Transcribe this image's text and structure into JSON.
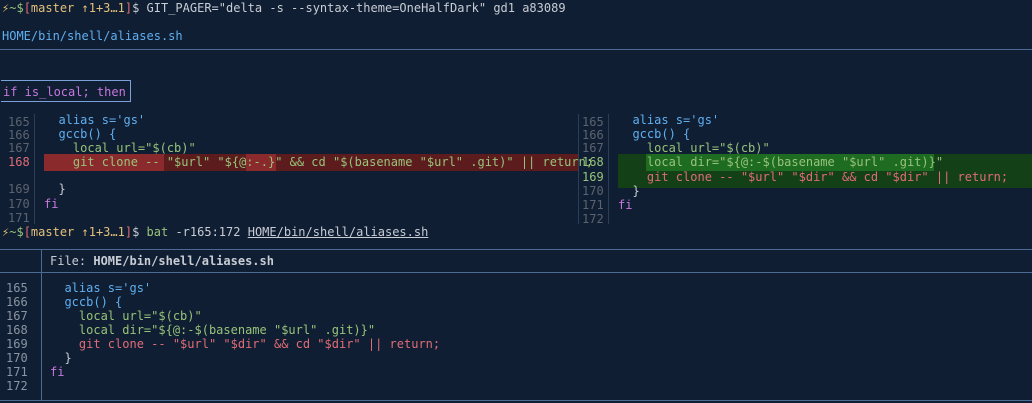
{
  "prompt1": {
    "bolt": "⚡",
    "path": "~$",
    "branch": "master ↑1+3…1",
    "command": "GIT_PAGER=\"delta -s --syntax-theme=OneHalfDark\" gd1 a83089"
  },
  "delta": {
    "file": "HOME/bin/shell/aliases.sh",
    "hunk": "if is_local; then",
    "left": {
      "line_numbers": [
        "165",
        "166",
        "167",
        "168",
        "",
        "169",
        "170",
        "171"
      ],
      "lines": [
        "  alias s='gs'",
        "  gccb() {",
        "    local url=\"$(cb)\"",
        "    git clone -- \"$url\" \"${@:-.}\" && cd \"$(basename \"$url\" .git)\" || return;",
        "",
        "  }",
        "fi",
        ""
      ]
    },
    "right": {
      "line_numbers": [
        "165",
        "166",
        "167",
        "168",
        "169",
        "170",
        "171",
        "172"
      ],
      "lines": [
        "  alias s='gs'",
        "  gccb() {",
        "    local url=\"$(cb)\"",
        "    local dir=\"${@:-$(basename \"$url\" .git)}\"",
        "    git clone -- \"$url\" \"$dir\" && cd \"$dir\" || return;",
        "  }",
        "fi",
        ""
      ]
    }
  },
  "prompt2": {
    "bolt": "⚡",
    "path": "~$",
    "branch": "master ↑1+3…1",
    "command_name": "bat",
    "command_args": "-r165:172",
    "command_file": "HOME/bin/shell/aliases.sh"
  },
  "bat": {
    "file_label": "File:",
    "file_name": "HOME/bin/shell/aliases.sh",
    "line_numbers": [
      "165",
      "166",
      "167",
      "168",
      "169",
      "170",
      "171",
      "172"
    ],
    "lines": [
      "  alias s='gs'",
      "  gccb() {",
      "    local url=\"$(cb)\"",
      "    local dir=\"${@:-$(basename \"$url\" .git)}\"",
      "    git clone -- \"$url\" \"$dir\" && cd \"$dir\" || return;",
      "  }",
      "fi",
      ""
    ]
  },
  "colors": {
    "background": "#0f1e33",
    "deleted_line": "#5c1c1e",
    "deleted_emphasis": "#8b2a2d",
    "added_line": "#144018",
    "added_emphasis": "#1e6b22"
  }
}
